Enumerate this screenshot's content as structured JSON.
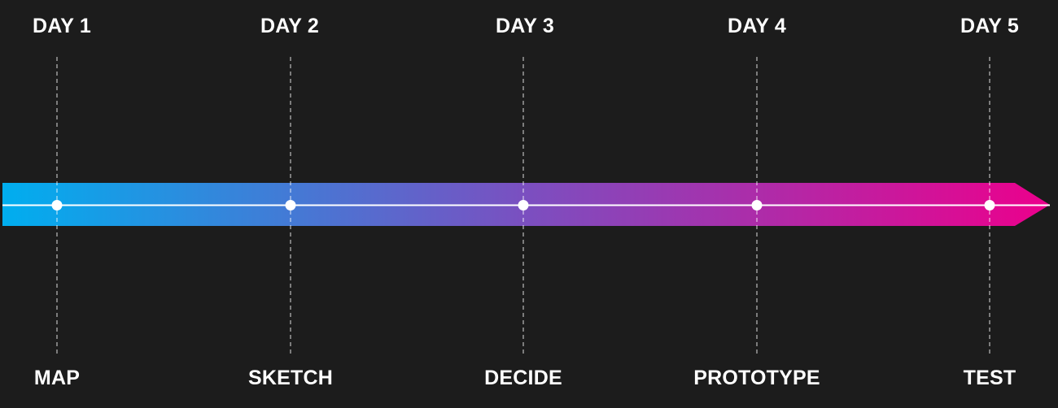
{
  "stages": [
    {
      "day": "DAY 1",
      "phase": "MAP"
    },
    {
      "day": "DAY 2",
      "phase": "SKETCH"
    },
    {
      "day": "DAY 3",
      "phase": "DECIDE"
    },
    {
      "day": "DAY 4",
      "phase": "PROTOTYPE"
    },
    {
      "day": "DAY 5",
      "phase": "TEST"
    }
  ],
  "colors": {
    "background": "#1c1c1c",
    "gradient_start": "#00aeef",
    "gradient_mid": "#7b4fc0",
    "gradient_end": "#ec008c",
    "text": "#ffffff",
    "line": "#ffffff"
  }
}
